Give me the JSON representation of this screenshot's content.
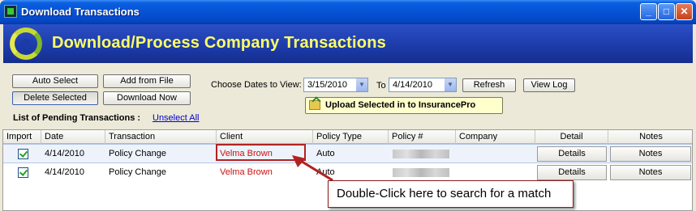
{
  "window": {
    "title": "Download Transactions",
    "buttons": {
      "minimize": "_",
      "maximize": "□",
      "close": "✕"
    }
  },
  "banner": {
    "title": "Download/Process Company Transactions"
  },
  "toolbar": {
    "auto_select": "Auto Select",
    "add_from_file": "Add from File",
    "delete_selected": "Delete Selected",
    "download_now": "Download Now",
    "choose_dates_label": "Choose Dates to View:",
    "date_from": "3/15/2010",
    "to_label": "To",
    "date_to": "4/14/2010",
    "refresh": "Refresh",
    "view_log": "View Log",
    "upload": "Upload Selected in to InsurancePro"
  },
  "list": {
    "label": "List of Pending Transactions :",
    "unselect_all": "Unselect All"
  },
  "grid": {
    "columns": [
      "Import",
      "Date",
      "Transaction",
      "Client",
      "Policy Type",
      "Policy #",
      "Company",
      "Detail",
      "Notes"
    ],
    "rows": [
      {
        "import": true,
        "date": "4/14/2010",
        "transaction": "Policy Change",
        "client": "Velma Brown",
        "policy_type": "Auto",
        "company": "",
        "detail": "Details",
        "notes": "Notes"
      },
      {
        "import": true,
        "date": "4/14/2010",
        "transaction": "Policy Change",
        "client": "Velma Brown",
        "policy_type": "Auto",
        "company": "",
        "detail": "Details",
        "notes": "Notes"
      }
    ]
  },
  "callout": {
    "text": "Double-Click here to search for a match",
    "color": "#b22222"
  }
}
